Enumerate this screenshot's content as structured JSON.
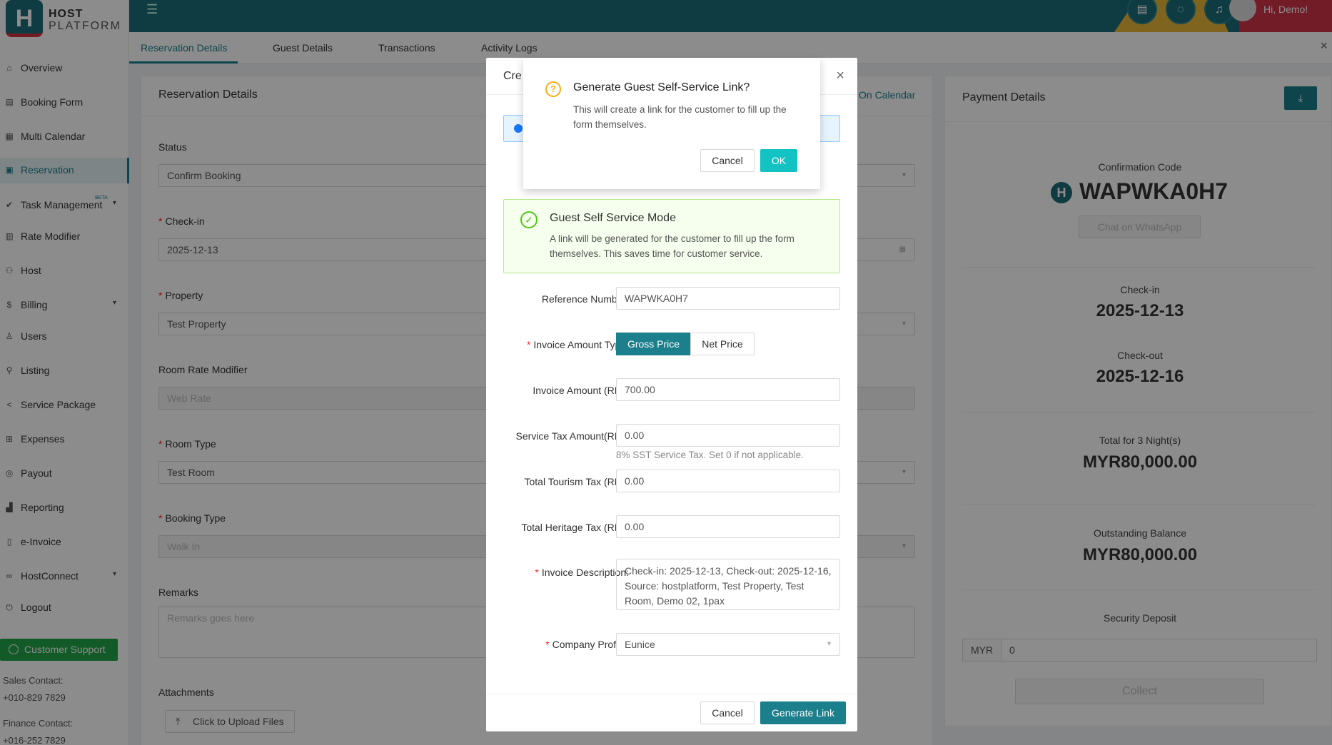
{
  "logo": {
    "line1": "HOST",
    "line2": "PLATFORM",
    "mark": "H"
  },
  "sidebar": {
    "items": [
      {
        "label": "Overview",
        "icon": "home-icon"
      },
      {
        "label": "Booking Form",
        "icon": "form-icon"
      },
      {
        "label": "Multi Calendar",
        "icon": "calendar-icon"
      },
      {
        "label": "Reservation",
        "icon": "reservation-icon"
      },
      {
        "label": "Task Management",
        "icon": "task-icon",
        "badge": "BETA"
      },
      {
        "label": "Rate Modifier",
        "icon": "rate-icon"
      },
      {
        "label": "Host",
        "icon": "host-icon"
      },
      {
        "label": "Billing",
        "icon": "billing-icon"
      },
      {
        "label": "Users",
        "icon": "user-icon"
      },
      {
        "label": "Listing",
        "icon": "listing-icon"
      },
      {
        "label": "Service Package",
        "icon": "share-icon"
      },
      {
        "label": "Expenses",
        "icon": "cart-icon"
      },
      {
        "label": "Payout",
        "icon": "payout-icon"
      },
      {
        "label": "Reporting",
        "icon": "chart-icon"
      },
      {
        "label": "e-Invoice",
        "icon": "invoice-icon"
      },
      {
        "label": "HostConnect",
        "icon": "link-icon"
      },
      {
        "label": "Logout",
        "icon": "logout-icon"
      }
    ],
    "support": "Customer Support",
    "sales_label": "Sales Contact:",
    "sales_phone": "+010-829 7829",
    "finance_label": "Finance Contact:",
    "finance_phone": "+016-252 7829"
  },
  "header": {
    "greeting": "Hi, Demo!"
  },
  "tabs": [
    "Reservation Details",
    "Guest Details",
    "Transactions",
    "Activity Logs"
  ],
  "reservation": {
    "title": "Reservation Details",
    "on_calendar": "On Calendar",
    "status_label": "Status",
    "status_value": "Confirm Booking",
    "checkin_label": "Check-in",
    "checkin_value": "2025-12-13",
    "property_label": "Property",
    "property_value": "Test Property",
    "rrm_label": "Room Rate Modifier",
    "rrm_placeholder": "Web Rate",
    "roomtype_label": "Room Type",
    "roomtype_value": "Test Room",
    "bookingtype_label": "Booking Type",
    "bookingtype_placeholder": "Walk In",
    "remarks_label": "Remarks",
    "remarks_placeholder": "Remarks goes here",
    "attachments_label": "Attachments",
    "upload_label": "Click to Upload Files"
  },
  "payment": {
    "title": "Payment Details",
    "conf_label": "Confirmation Code",
    "conf_code": "WAPWKA0H7",
    "chat_label": "Chat on WhatsApp",
    "checkin_label": "Check-in",
    "checkin_value": "2025-12-13",
    "checkout_label": "Check-out",
    "checkout_value": "2025-12-16",
    "total_label": "Total for 3 Night(s)",
    "total_value": "MYR80,000.00",
    "outstanding_label": "Outstanding Balance",
    "outstanding_value": "MYR80,000.00",
    "deposit_label": "Security Deposit",
    "deposit_currency": "MYR",
    "deposit_value": "0",
    "collect_label": "Collect"
  },
  "modal": {
    "title": "Cre",
    "self_service_title": "Guest Self Service Mode",
    "self_service_desc": "A link will be generated for the customer to fill up the form themselves. This saves time for customer service.",
    "ref_label": "Reference Number:",
    "ref_value": "WAPWKA0H7",
    "amount_type_label": "Invoice Amount Type:",
    "gross_label": "Gross Price",
    "net_label": "Net Price",
    "invoice_amount_label": "Invoice Amount (RM):",
    "invoice_amount_value": "700.00",
    "service_tax_label": "Service Tax Amount(RM):",
    "service_tax_value": "0.00",
    "service_tax_help": "8% SST Service Tax. Set 0 if not applicable.",
    "tourism_label": "Total Tourism Tax (RM):",
    "tourism_value": "0.00",
    "heritage_label": "Total Heritage Tax (RM):",
    "heritage_value": "0.00",
    "desc_label": "Invoice Description:",
    "desc_value": "Check-in: 2025-12-13, Check-out: 2025-12-16, Source: hostplatform, Test Property, Test Room, Demo 02, 1pax",
    "company_label": "Company Profile:",
    "company_value": "Eunice",
    "cancel_label": "Cancel",
    "generate_label": "Generate Link"
  },
  "confirm": {
    "title": "Generate Guest Self-Service Link?",
    "desc": "This will create a link for the customer to fill up the form themselves.",
    "cancel_label": "Cancel",
    "ok_label": "OK"
  },
  "colors": {
    "primary": "#1b7f8c",
    "header": "#1b6e79",
    "ok_button": "#13c2c2",
    "success": "#52c41a",
    "warning": "#faad14"
  }
}
